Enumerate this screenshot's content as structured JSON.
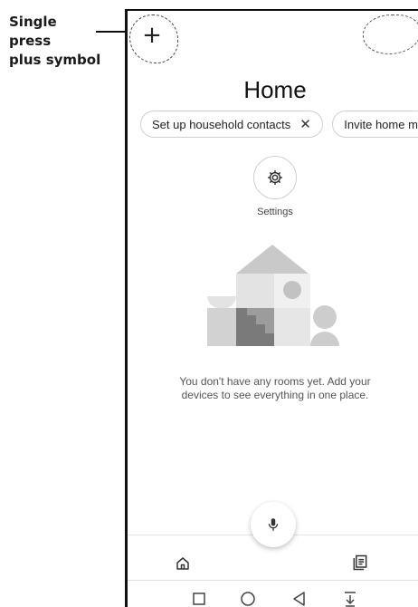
{
  "annotation": {
    "lines": [
      "Single",
      "press",
      "plus symbol"
    ]
  },
  "header": {
    "add_icon": "plus-icon",
    "title": "Home"
  },
  "chips": [
    {
      "label": "Set up household contacts",
      "close": "✕"
    },
    {
      "label": "Invite home m"
    }
  ],
  "settings": {
    "icon": "gear-icon",
    "label": "Settings"
  },
  "empty_state": {
    "message": "You don't have any rooms yet. Add your devices to see everything in one place."
  },
  "bottom_nav": {
    "mic_icon": "microphone-icon",
    "home_icon": "home-icon",
    "feed_icon": "feed-icon"
  },
  "system_nav": [
    "recents-square-icon",
    "home-circle-icon",
    "back-triangle-icon",
    "notification-expand-icon"
  ],
  "colors": {
    "illustration_light": "#e0e0e0",
    "illustration_mid": "#c7c7c7",
    "illustration_dark": "#8a8a8a"
  }
}
